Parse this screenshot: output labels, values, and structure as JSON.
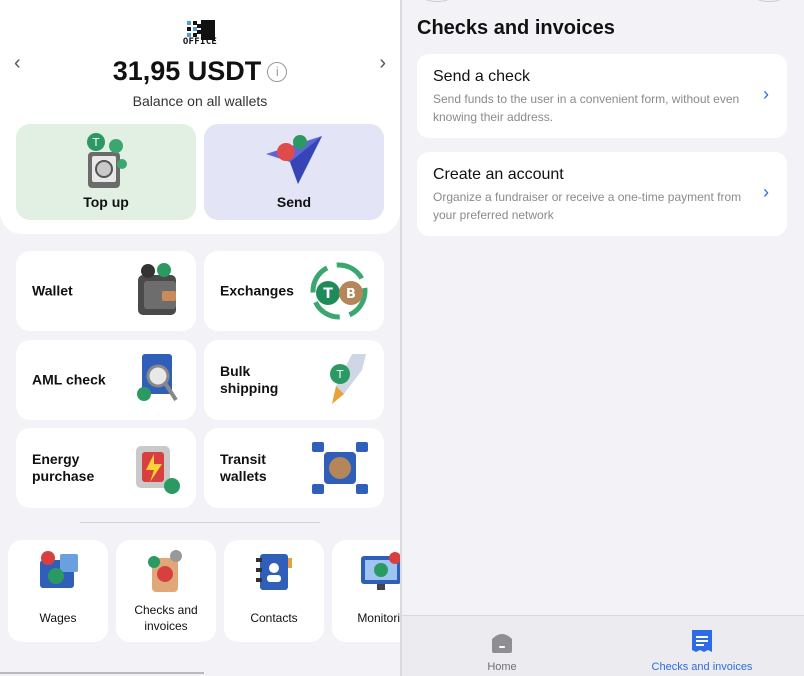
{
  "header": {
    "logo_text": "OFFICE",
    "balance": "31,95 USDT",
    "balance_info": "i",
    "balance_caption": "Balance on all wallets",
    "prev_arrow": "‹",
    "next_arrow": "›"
  },
  "actions": [
    {
      "label": "Top up",
      "icon": "top-up-icon"
    },
    {
      "label": "Send",
      "icon": "send-icon"
    }
  ],
  "tiles": [
    {
      "label": "Wallet",
      "icon": "wallet-icon"
    },
    {
      "label": "Exchanges",
      "icon": "exchanges-icon"
    },
    {
      "label": "AML check",
      "icon": "aml-check-icon"
    },
    {
      "label": "Bulk\nshipping",
      "icon": "bulk-shipping-icon"
    },
    {
      "label": "Energy\npurchase",
      "icon": "energy-purchase-icon"
    },
    {
      "label": "Transit\nwallets",
      "icon": "transit-wallets-icon"
    }
  ],
  "shortcuts": [
    {
      "label": "Wages",
      "icon": "wages-icon"
    },
    {
      "label": "Checks and\ninvoices",
      "icon": "checks-invoices-icon"
    },
    {
      "label": "Contacts",
      "icon": "contacts-icon"
    },
    {
      "label": "Monitorin",
      "icon": "monitoring-icon"
    }
  ],
  "right": {
    "title": "Checks and invoices",
    "cards": [
      {
        "title": "Send a check",
        "description": "Send funds to the user in a convenient form, without even knowing their address."
      },
      {
        "title": "Create an account",
        "description": "Organize a fundraiser or receive a one-time payment from your preferred network"
      }
    ],
    "chevron": "›"
  },
  "tabbar": {
    "tabs": [
      {
        "label": "Home",
        "icon": "home-icon",
        "active": false
      },
      {
        "label": "Checks and invoices",
        "icon": "receipt-icon",
        "active": true
      }
    ]
  },
  "colors": {
    "accent": "#2e6be6",
    "topup_bg": "#e2efe3",
    "send_bg": "#e3e4f5",
    "tether_green": "#1f8a5a"
  }
}
